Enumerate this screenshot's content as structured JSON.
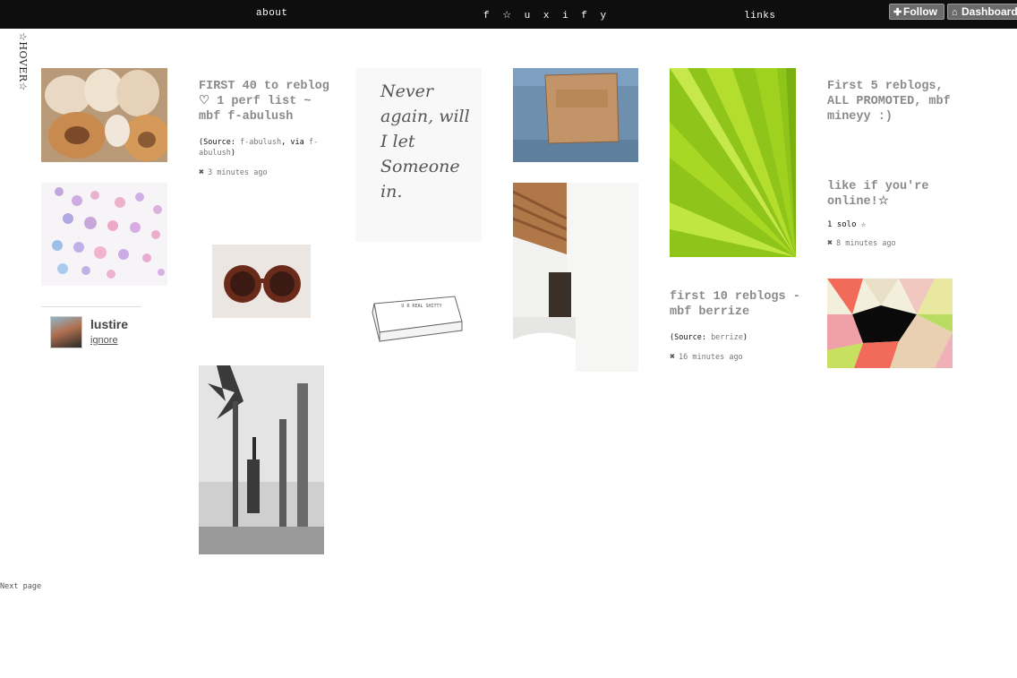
{
  "topbar": {
    "about": "about",
    "title": "f ☆ u x i f y",
    "links": "links",
    "follow_label": "Follow",
    "dashboard_label": "Dashboard",
    "follow_icon": "plus-icon",
    "dashboard_icon": "home-icon"
  },
  "sidebar": {
    "hover_label": "☆HOVER☆"
  },
  "posts": {
    "text1": {
      "title": "FIRST 40 to reblog ♡ 1 perf list ~ mbf f-abulush",
      "source_label": "(Source: ",
      "source_link": "f-abulush",
      "via_label": ", via",
      "via_link": "f-abulush",
      "close_paren": ")",
      "time": "3 minutes ago"
    },
    "text2": {
      "title": "first 10 reblogs - mbf berrize",
      "source_label": "(Source: ",
      "source_link": "berrize",
      "close_paren": ")",
      "time": "16 minutes ago"
    },
    "text3": {
      "title": "First 5 reblogs, ALL PROMOTED, mbf mineyy :)"
    },
    "text4": {
      "title": "like if you're online!☆",
      "body": "1 solo ☆",
      "time": "8 minutes ago"
    },
    "handwritten_note": "Never again, will I let Someone in.",
    "cake_text": "U R REAL SHITTY",
    "meta_icon": "close-icon"
  },
  "user_card": {
    "name": "lustire",
    "action": "ignore"
  },
  "pagination": {
    "next": "Next page"
  }
}
